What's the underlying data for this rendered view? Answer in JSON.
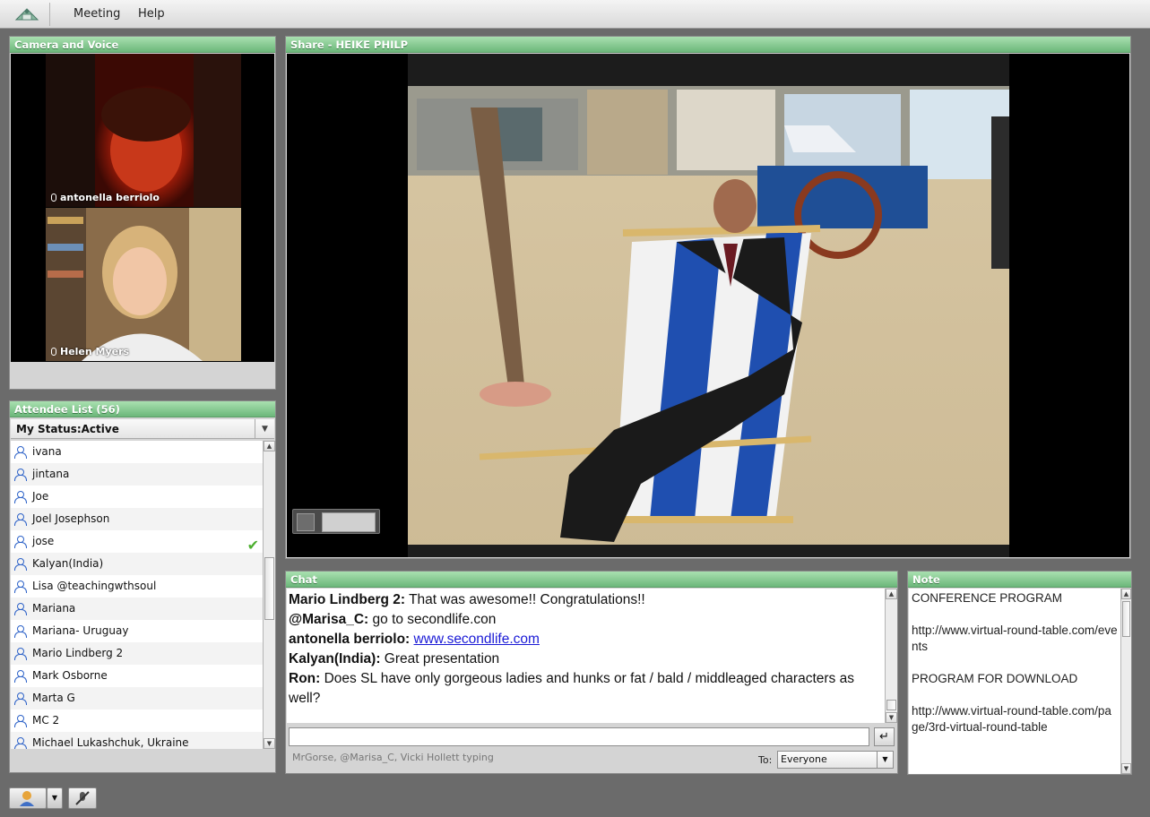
{
  "menubar": {
    "items": [
      "Meeting",
      "Help"
    ]
  },
  "camera": {
    "title": "Camera and Voice",
    "participants": [
      {
        "name": "antonella berriolo"
      },
      {
        "name": "Helen Myers"
      }
    ]
  },
  "attendees": {
    "title": "Attendee List (56)",
    "status": "My Status:Active",
    "items": [
      {
        "name": "ivana"
      },
      {
        "name": "jintana"
      },
      {
        "name": "Joe"
      },
      {
        "name": "Joel Josephson"
      },
      {
        "name": "jose",
        "checked": true
      },
      {
        "name": "Kalyan(India)"
      },
      {
        "name": "Lisa @teachingwthsoul"
      },
      {
        "name": "Mariana"
      },
      {
        "name": "Mariana- Uruguay"
      },
      {
        "name": "Mario Lindberg 2"
      },
      {
        "name": "Mark Osborne"
      },
      {
        "name": "Marta G"
      },
      {
        "name": "MC 2"
      },
      {
        "name": "Michael Lukashchuk, Ukraine"
      }
    ]
  },
  "share": {
    "title": "Share - HEIKE PHILP"
  },
  "chat": {
    "title": "Chat",
    "messages": [
      {
        "sender": "Mario Lindberg 2:",
        "text": "That was awesome!! Congratulations!!"
      },
      {
        "sender": "@Marisa_C:",
        "text": "go to secondlife.con"
      },
      {
        "sender": "antonella berriolo:",
        "link": "www.secondlife.com"
      },
      {
        "sender": "Kalyan(India):",
        "text": "Great presentation"
      },
      {
        "sender": "Ron:",
        "text": "Does SL have only gorgeous ladies and hunks or fat / bald / middleaged characters as well?"
      }
    ],
    "typing": "MrGorse, @Marisa_C, Vicki Hollett typing",
    "to_label": "To:",
    "to_value": "Everyone"
  },
  "note": {
    "title": "Note",
    "text": "CONFERENCE PROGRAM\n\nhttp://www.virtual-round-table.com/events\n\nPROGRAM FOR DOWNLOAD\n\nhttp://www.virtual-round-table.com/page/3rd-virtual-round-table"
  },
  "colors": {
    "header_green": "#6cb77a",
    "link_blue": "#1a1ad6",
    "check_green": "#4caf2f"
  }
}
